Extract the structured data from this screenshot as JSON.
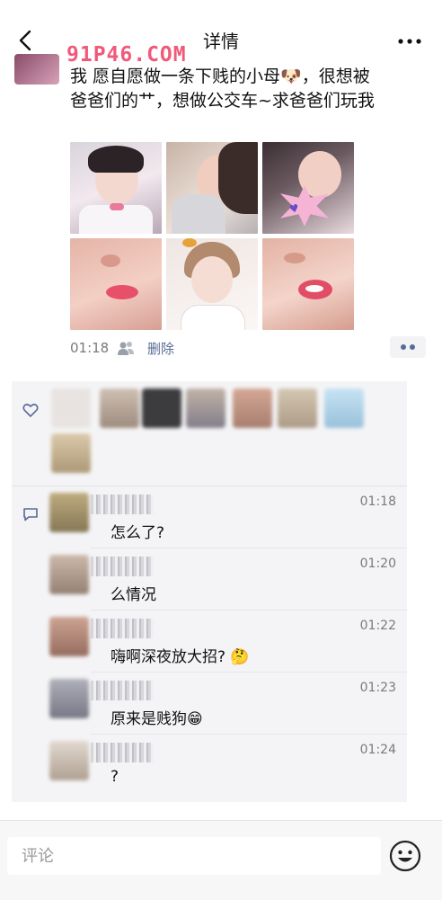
{
  "nav": {
    "title": "详情"
  },
  "watermark": "91P46.COM",
  "post": {
    "text": "我  愿自愿做一条下贱的小母🐶，很想被爸爸们的艹，想做公交车~求爸爸们玩我",
    "time": "01:18",
    "delete_label": "删除"
  },
  "photos": [
    {
      "icon": "photo-girl-selfie"
    },
    {
      "icon": "photo-girl-closeup"
    },
    {
      "icon": "photo-girl-sticker"
    },
    {
      "icon": "photo-lips-closeup"
    },
    {
      "icon": "photo-girl-bangs"
    },
    {
      "icon": "photo-lips-closeup-2"
    }
  ],
  "comments": [
    {
      "time": "01:18",
      "text": "怎么了?"
    },
    {
      "time": "01:20",
      "text": "么情况"
    },
    {
      "time": "01:22",
      "text": "嗨啊深夜放大招? 🤔"
    },
    {
      "time": "01:23",
      "text": "原来是贱狗😁"
    },
    {
      "time": "01:24",
      "text": "?"
    }
  ],
  "input": {
    "placeholder": "评论"
  },
  "colors": {
    "link": "#576b95",
    "watermark": "#f05a7a",
    "panel": "#f4f4f6"
  }
}
